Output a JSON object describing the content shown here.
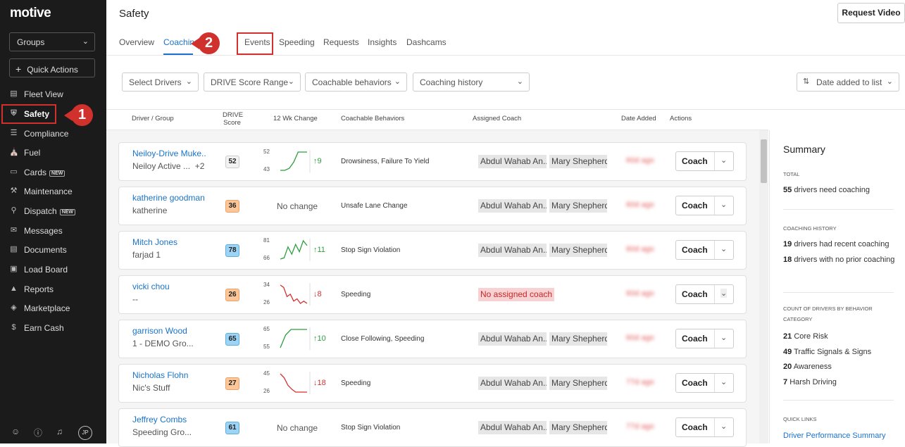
{
  "sidebar": {
    "logo": "motive",
    "groups_label": "Groups",
    "quick_actions_label": "Quick Actions",
    "items": [
      {
        "label": "Fleet View",
        "icon": "book-icon"
      },
      {
        "label": "Safety",
        "icon": "shield-icon"
      },
      {
        "label": "Compliance",
        "icon": "list-icon"
      },
      {
        "label": "Fuel",
        "icon": "fuel-icon"
      },
      {
        "label": "Cards",
        "icon": "card-icon",
        "badge": "NEW"
      },
      {
        "label": "Maintenance",
        "icon": "wrench-icon"
      },
      {
        "label": "Dispatch",
        "icon": "pin-icon",
        "badge": "NEW"
      },
      {
        "label": "Messages",
        "icon": "chat-icon"
      },
      {
        "label": "Documents",
        "icon": "document-icon"
      },
      {
        "label": "Load Board",
        "icon": "truck-icon"
      },
      {
        "label": "Reports",
        "icon": "chart-icon"
      },
      {
        "label": "Marketplace",
        "icon": "layers-icon"
      },
      {
        "label": "Earn Cash",
        "icon": "dollar-icon"
      }
    ],
    "avatar_initials": "JP"
  },
  "annotations": {
    "callout_1": "1",
    "callout_2": "2"
  },
  "header": {
    "title": "Safety",
    "request_video": "Request Video"
  },
  "tabs": [
    "Overview",
    "Coaching",
    "Events",
    "Speeding",
    "Requests",
    "Insights",
    "Dashcams"
  ],
  "filters": {
    "select_drivers": "Select Drivers",
    "drive_score_range": "DRIVE Score Range",
    "coachable_behaviors": "Coachable behaviors",
    "coaching_history": "Coaching history",
    "sort": "Date added to list"
  },
  "table": {
    "headers": {
      "driver": "Driver / Group",
      "drive_score_1": "DRIVE",
      "drive_score_2": "Score",
      "change": "12 Wk Change",
      "behaviors": "Coachable Behaviors",
      "coach": "Assigned Coach",
      "date": "Date Added",
      "actions": "Actions"
    },
    "coach_label": "Coach",
    "rows": [
      {
        "name": "Neiloy-Drive Muke...",
        "group": "Neiloy Active ...",
        "extra": "+2",
        "score": "52",
        "score_color": "#f2f2f2",
        "high": "52",
        "low": "43",
        "delta": "↑9",
        "trend": "up",
        "points": [
          43,
          43,
          44,
          47,
          52,
          52,
          52
        ],
        "behaviors": "Drowsiness, Failure To Yield",
        "coach1": "Abdul Wahab An...",
        "coach2": "Mary Shepherd",
        "date": "60d ago"
      },
      {
        "name": "katherine goodman",
        "group": "katherine",
        "score": "36",
        "score_color": "#fbc79a",
        "no_change": "No change",
        "behaviors": "Unsafe Lane Change",
        "coach1": "Abdul Wahab An...",
        "coach2": "Mary Shepherd",
        "date": "60d ago"
      },
      {
        "name": "Mitch Jones",
        "group": "farjad 1",
        "score": "78",
        "score_color": "#9dd3f5",
        "high": "81",
        "low": "66",
        "delta": "↑11",
        "trend": "up",
        "points": [
          66,
          67,
          76,
          70,
          78,
          72,
          81,
          77
        ],
        "behaviors": "Stop Sign Violation",
        "coach1": "Abdul Wahab An...",
        "coach2": "Mary Shepherd",
        "date": "60d ago"
      },
      {
        "name": "vicki chou",
        "group": "--",
        "score": "26",
        "score_color": "#fbc79a",
        "high": "34",
        "low": "26",
        "delta": "↓8",
        "trend": "down",
        "points": [
          34,
          33,
          29,
          30,
          27,
          28,
          26,
          27,
          26
        ],
        "behaviors": "Speeding",
        "no_coach": "No assigned coach",
        "date": "60d ago"
      },
      {
        "name": "garrison Wood",
        "group": "1 - DEMO Gro...",
        "score": "65",
        "score_color": "#9dd3f5",
        "high": "65",
        "low": "55",
        "delta": "↑10",
        "trend": "up",
        "points": [
          55,
          62,
          65,
          65,
          65,
          65
        ],
        "behaviors": "Close Following, Speeding",
        "coach1": "Abdul Wahab An...",
        "coach2": "Mary Shepherd",
        "date": "60d ago"
      },
      {
        "name": "Nicholas Flohn",
        "group": "Nic's Stuff",
        "score": "27",
        "score_color": "#fbc79a",
        "high": "45",
        "low": "26",
        "delta": "↓18",
        "trend": "down",
        "points": [
          45,
          41,
          33,
          29,
          26,
          26,
          26,
          26
        ],
        "behaviors": "Speeding",
        "coach1": "Abdul Wahab An...",
        "coach2": "Mary Shepherd",
        "date": "77d ago"
      },
      {
        "name": "Jeffrey Combs",
        "group": "Speeding Gro...",
        "score": "61",
        "score_color": "#9dd3f5",
        "no_change": "No change",
        "behaviors": "Stop Sign Violation",
        "coach1": "Abdul Wahab An...",
        "coach2": "Mary Shepherd",
        "date": "77d ago"
      }
    ]
  },
  "summary": {
    "title": "Summary",
    "total_label": "TOTAL",
    "total_num": "55",
    "total_text": "drivers need coaching",
    "history_label": "COACHING HISTORY",
    "recent_num": "19",
    "recent_text": "drivers had recent coaching",
    "noprior_num": "18",
    "noprior_text": "drivers with no prior coaching",
    "category_label": "COUNT OF DRIVERS BY BEHAVIOR CATEGORY",
    "categories": [
      {
        "num": "21",
        "label": "Core Risk"
      },
      {
        "num": "49",
        "label": "Traffic Signals & Signs"
      },
      {
        "num": "20",
        "label": "Awareness"
      },
      {
        "num": "7",
        "label": "Harsh Driving"
      }
    ],
    "quick_links_label": "QUICK LINKS",
    "link": "Driver Performance Summary"
  },
  "colors": {
    "accent": "#1a73c9",
    "highlight": "#d0312d",
    "up": "#2e9e3e",
    "down": "#d32f2f"
  }
}
